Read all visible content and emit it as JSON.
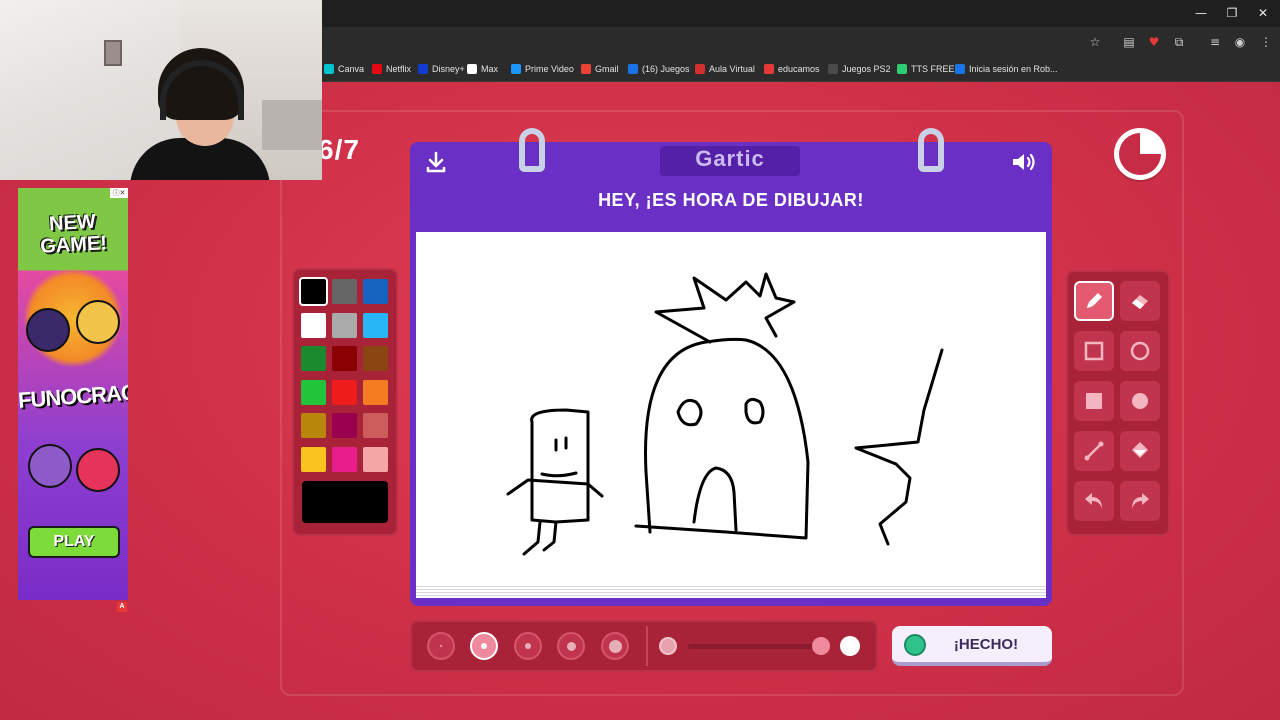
{
  "browser": {
    "window_controls": [
      "—",
      "❐",
      "✕"
    ],
    "toolbar_icons": [
      "☆",
      "▤",
      "♥",
      "⧉",
      "≡",
      "◉",
      "⋮"
    ],
    "bookmarks": [
      {
        "label": "Canva",
        "color": "#00c4cc"
      },
      {
        "label": "Netflix",
        "color": "#e50914"
      },
      {
        "label": "Disney+",
        "color": "#113ccf"
      },
      {
        "label": "Max",
        "color": "#ffffff"
      },
      {
        "label": "Prime Video",
        "color": "#1a98ff"
      },
      {
        "label": "Gmail",
        "color": "#ea4335"
      },
      {
        "label": "(16) Juegos",
        "color": "#1a73e8"
      },
      {
        "label": "Aula Virtual",
        "color": "#d32f2f"
      },
      {
        "label": "educamos",
        "color": "#e53935"
      },
      {
        "label": "Juegos PS2",
        "color": "#4a4a4a"
      },
      {
        "label": "TTS FREE",
        "color": "#2ecc71"
      },
      {
        "label": "Inicia sesión en Rob...",
        "color": "#1a73e8"
      }
    ]
  },
  "game": {
    "round": "6/7",
    "logo": "Gartic",
    "heading": "HEY, ¡ES HORA DE DIBUJAR!",
    "done_label": "¡HECHO!",
    "timer_remaining_fraction": 0.75,
    "active_color": "#000000",
    "active_tool": "pencil",
    "active_brush_index": 1,
    "palette": [
      "#000000",
      "#666666",
      "#1565c0",
      "#ffffff",
      "#aaaaaa",
      "#29b6f6",
      "#1b8a2e",
      "#8b0000",
      "#8b4513",
      "#22c43a",
      "#ef1c1c",
      "#f57c20",
      "#b8860b",
      "#99004d",
      "#cd5c5c",
      "#f9c21d",
      "#e91e8c",
      "#f4a6a6"
    ],
    "tools": [
      "pencil",
      "eraser",
      "rectangle-outline",
      "circle-outline",
      "rectangle-filled",
      "circle-filled",
      "line",
      "fill-bucket",
      "undo",
      "redo"
    ]
  },
  "ad": {
    "title": "NEW GAME!",
    "brand": "FUNOCRACY",
    "cta": "PLAY",
    "close": "ⓘ✕",
    "adchoice": "A"
  }
}
